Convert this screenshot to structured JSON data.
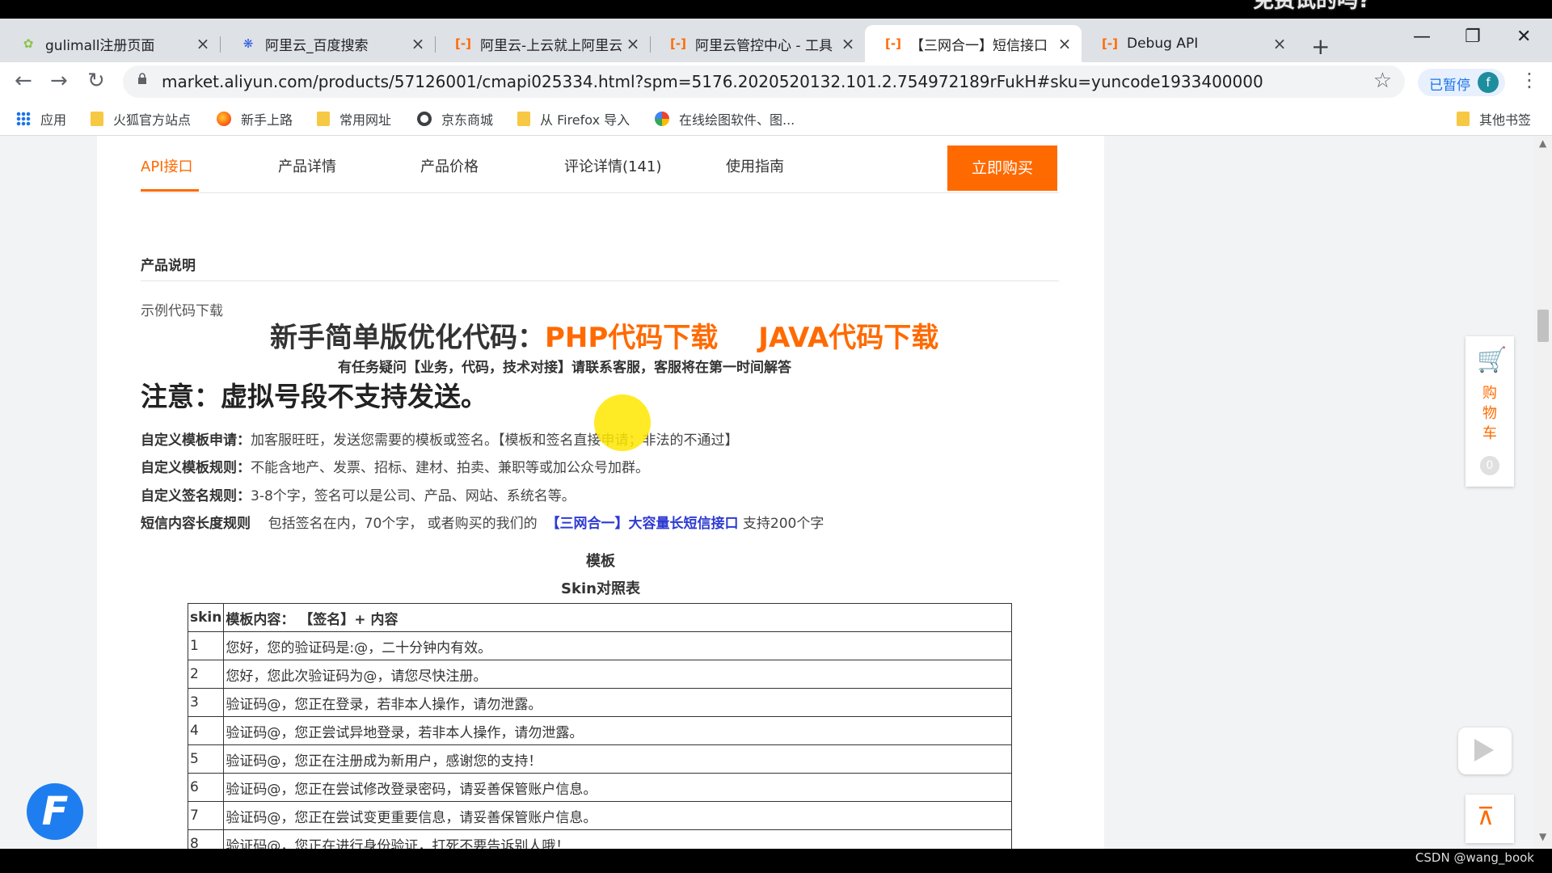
{
  "overlay_caption": "免费试的吗?",
  "tabs": [
    {
      "title": "gulimall注册页面",
      "icon": "leaf-icon",
      "active": false
    },
    {
      "title": "阿里云_百度搜索",
      "icon": "baidu-paw-icon",
      "active": false
    },
    {
      "title": "阿里云-上云就上阿里云",
      "icon": "aliyun-icon",
      "active": false
    },
    {
      "title": "阿里云管控中心 - 工具",
      "icon": "aliyun-icon",
      "active": false
    },
    {
      "title": "【三网合一】短信接口",
      "icon": "aliyun-icon",
      "active": true
    },
    {
      "title": "Debug API",
      "icon": "aliyun-icon",
      "active": false
    }
  ],
  "toolbar": {
    "url": "market.aliyun.com/products/57126001/cmapi025334.html?spm=5176.2020520132.101.2.754972189rFukH#sku=yuncode1933400000",
    "profile_label": "已暂停",
    "avatar_letter": "f"
  },
  "bookmarks": [
    "应用",
    "火狐官方站点",
    "新手上路",
    "常用网址",
    "京东商城",
    "从 Firefox 导入",
    "在线绘图软件、图...",
    "其他书签"
  ],
  "nav": {
    "tabs": [
      "API接口",
      "产品详情",
      "产品价格",
      "评论详情(141)",
      "使用指南"
    ],
    "buy_label": "立即购买"
  },
  "content": {
    "section_title": "产品说明",
    "sample_download": "示例代码下载",
    "big_prefix": "新手简单版优化代码：",
    "php_link": "PHP代码下载",
    "java_link": "JAVA代码下载",
    "support_line": "有任务疑问【业务，代码，技术对接】请联系客服，客服将在第一时间解答",
    "notice": "注意：虚拟号段不支持发送。",
    "rules": [
      {
        "label": "自定义模板申请：",
        "text": "加客服旺旺，发送您需要的模板或签名。【模板和签名直接申请；非法的不通过】"
      },
      {
        "label": "自定义模板规则：",
        "text": "不能含地产、发票、招标、建材、拍卖、兼职等或加公众号加群。"
      },
      {
        "label": "自定义签名规则：",
        "text": "3-8个字，签名可以是公司、产品、网站、系统名等。"
      }
    ],
    "length_rule": {
      "label": "短信内容长度规则",
      "text": "包括签名在内，70个字， 或者购买的我们的",
      "link": "【三网合一】大容量长短信接口",
      "suffix": " 支持200个字"
    },
    "template_title": "模板",
    "skin_table_title": "Skin对照表"
  },
  "skin_table": {
    "headers": [
      "skin",
      "模板内容：  【签名】+ 内容"
    ],
    "rows": [
      [
        "1",
        "您好，您的验证码是:@，二十分钟内有效。"
      ],
      [
        "2",
        "您好，您此次验证码为@，请您尽快注册。"
      ],
      [
        "3",
        "验证码@，您正在登录，若非本人操作，请勿泄露。"
      ],
      [
        "4",
        "验证码@，您正尝试异地登录，若非本人操作，请勿泄露。"
      ],
      [
        "5",
        "验证码@，您正在注册成为新用户，感谢您的支持！"
      ],
      [
        "6",
        "验证码@，您正在尝试修改登录密码，请妥善保管账户信息。"
      ],
      [
        "7",
        "验证码@，您正在尝试变更重要信息，请妥善保管账户信息。"
      ],
      [
        "8",
        "验证码@，您正在进行身份验证，打死不要告诉别人哦！"
      ]
    ]
  },
  "side": {
    "cart_label": "购物车",
    "cart_count": "0"
  },
  "watermark": "CSDN @wang_book",
  "colors": {
    "accent": "#ff6a00",
    "link_blue": "#2e3bd1"
  }
}
